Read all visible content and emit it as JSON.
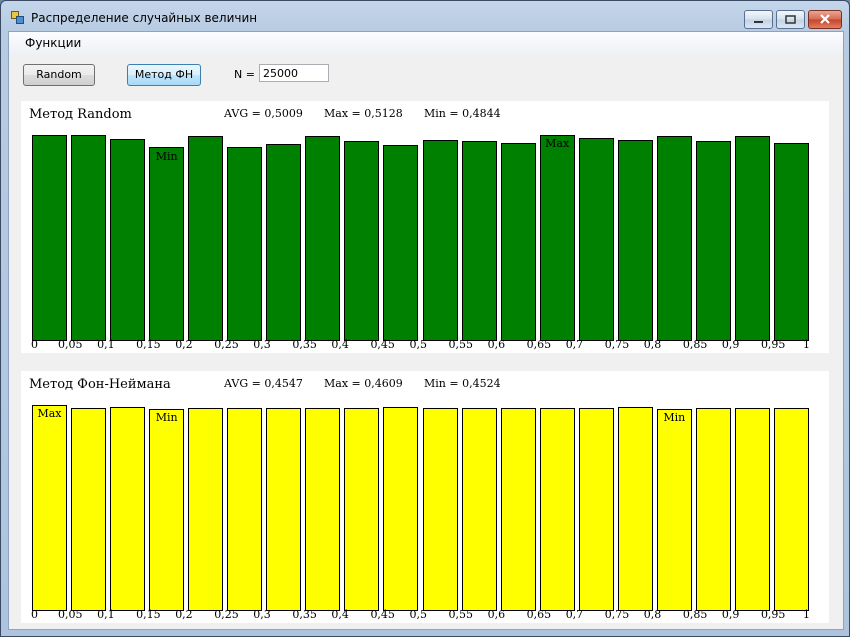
{
  "window": {
    "title": "Распределение случайных величин"
  },
  "menu": {
    "functions": "Функции"
  },
  "toolbar": {
    "random_button": "Random",
    "fn_button": "Метод ФН",
    "n_label": "N =",
    "n_value": "25000"
  },
  "colors": {
    "random_bar": "#008000",
    "fn_bar": "#ffff00"
  },
  "x_ticks": [
    "0",
    "0,05",
    "0,1",
    "0,15",
    "0,2",
    "0,25",
    "0,3",
    "0,35",
    "0,4",
    "0,45",
    "0,5",
    "0,55",
    "0,6",
    "0,65",
    "0,7",
    "0,75",
    "0,8",
    "0,85",
    "0,9",
    "0,95",
    "1"
  ],
  "panels": [
    {
      "title": "Метод Random",
      "avg_text": "AVG = 0,5009",
      "max_text": "Max = 0,5128",
      "min_text": "Min = 0,4844",
      "max_label": "Max",
      "min_label": "Min"
    },
    {
      "title": "Метод Фон-Неймана",
      "avg_text": "AVG = 0,4547",
      "max_text": "Max = 0,4609",
      "min_text": "Min = 0,4524",
      "max_label": "Max",
      "min_label": "Min"
    }
  ],
  "chart_data": [
    {
      "type": "bar",
      "title": "Метод Random",
      "categories": [
        "0–0,05",
        "0,05–0,1",
        "0,1–0,15",
        "0,15–0,2",
        "0,2–0,25",
        "0,25–0,3",
        "0,3–0,35",
        "0,35–0,4",
        "0,4–0,45",
        "0,45–0,5",
        "0,5–0,55",
        "0,55–0,6",
        "0,6–0,65",
        "0,65–0,7",
        "0,7–0,75",
        "0,75–0,8",
        "0,8–0,85",
        "0,85–0,9",
        "0,9–0,95",
        "0,95–1"
      ],
      "values": [
        0.512,
        0.512,
        0.502,
        0.484,
        0.51,
        0.484,
        0.49,
        0.51,
        0.498,
        0.488,
        0.5,
        0.498,
        0.492,
        0.513,
        0.505,
        0.5,
        0.51,
        0.498,
        0.51,
        0.492
      ],
      "max_index": 13,
      "min_index": 3,
      "ylim": [
        0,
        0.55
      ]
    },
    {
      "type": "bar",
      "title": "Метод Фон-Неймана",
      "categories": [
        "0–0,05",
        "0,05–0,1",
        "0,1–0,15",
        "0,15–0,2",
        "0,2–0,25",
        "0,25–0,3",
        "0,3–0,35",
        "0,35–0,4",
        "0,4–0,45",
        "0,45–0,5",
        "0,5–0,55",
        "0,55–0,6",
        "0,6–0,65",
        "0,65–0,7",
        "0,7–0,75",
        "0,75–0,8",
        "0,8–0,85",
        "0,85–0,9",
        "0,9–0,95",
        "0,95–1"
      ],
      "values": [
        0.4609,
        0.4552,
        0.4575,
        0.4524,
        0.4552,
        0.4552,
        0.4552,
        0.4552,
        0.4535,
        0.4575,
        0.4541,
        0.4552,
        0.4552,
        0.4552,
        0.4552,
        0.4575,
        0.4524,
        0.4552,
        0.4552,
        0.4552
      ],
      "max_index": 0,
      "min_indices": [
        3,
        16
      ],
      "ylim": [
        0,
        0.5
      ]
    }
  ]
}
